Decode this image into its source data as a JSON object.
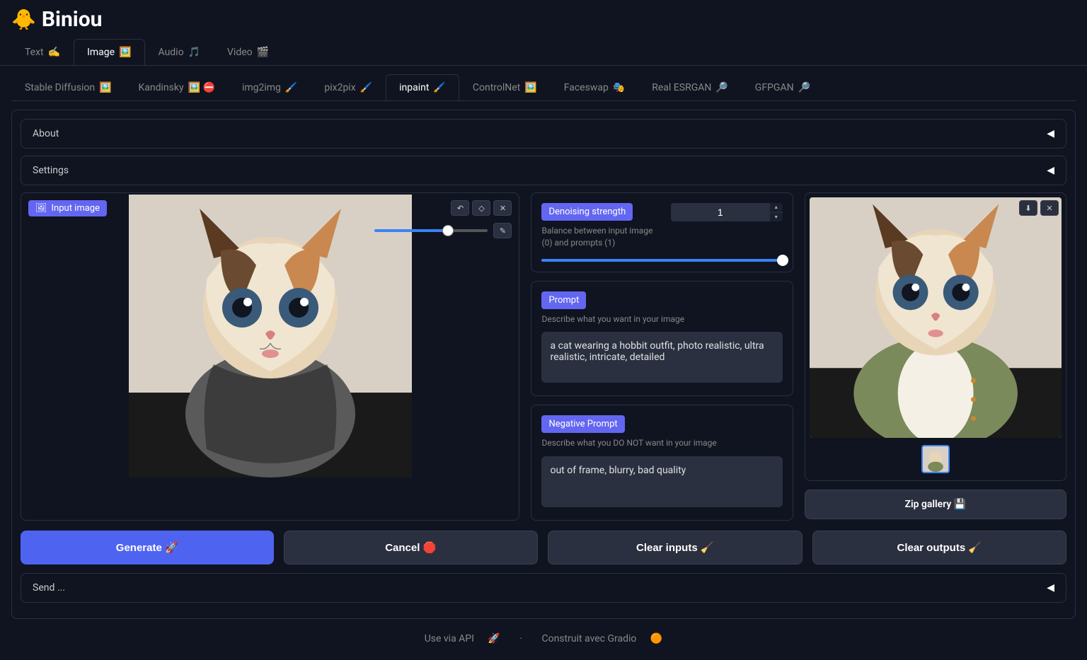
{
  "app": {
    "title": "Biniou",
    "logo": "🐥"
  },
  "main_tabs": [
    {
      "label": "Text",
      "emoji": "✍️"
    },
    {
      "label": "Image",
      "emoji": "🖼️"
    },
    {
      "label": "Audio",
      "emoji": "🎵"
    },
    {
      "label": "Video",
      "emoji": "🎬"
    }
  ],
  "sub_tabs": [
    {
      "label": "Stable Diffusion",
      "emoji": "🖼️"
    },
    {
      "label": "Kandinsky",
      "emoji": "🖼️ ⛔"
    },
    {
      "label": "img2img",
      "emoji": "🖌️"
    },
    {
      "label": "pix2pix",
      "emoji": "🖌️"
    },
    {
      "label": "inpaint",
      "emoji": "🖌️"
    },
    {
      "label": "ControlNet",
      "emoji": "🖼️"
    },
    {
      "label": "Faceswap",
      "emoji": "🎭"
    },
    {
      "label": "Real ESRGAN",
      "emoji": "🔎"
    },
    {
      "label": "GFPGAN",
      "emoji": "🔎"
    }
  ],
  "collapsibles": {
    "about": "About",
    "settings": "Settings",
    "send": "Send ..."
  },
  "input_image": {
    "badge": "Input image"
  },
  "denoising": {
    "label": "Denoising strength",
    "hint1": "Balance between input image",
    "hint2": "(0) and prompts (1)",
    "value": "1"
  },
  "prompt": {
    "label": "Prompt",
    "hint": "Describe what you want in your image",
    "value": "a cat wearing a hobbit outfit, photo realistic, ultra realistic, intricate, detailed"
  },
  "negative": {
    "label": "Negative Prompt",
    "hint": "Describe what you DO NOT want in your image",
    "value": "out of frame, blurry, bad quality"
  },
  "zip": {
    "label": "Zip gallery 💾"
  },
  "actions": {
    "generate": "Generate 🚀",
    "cancel": "Cancel 🛑",
    "clear_inputs": "Clear inputs 🧹",
    "clear_outputs": "Clear outputs 🧹"
  },
  "footer": {
    "api": "Use via API",
    "api_emoji": "🚀",
    "sep": "·",
    "gradio": "Construit avec Gradio",
    "gradio_emoji": "🟠"
  }
}
